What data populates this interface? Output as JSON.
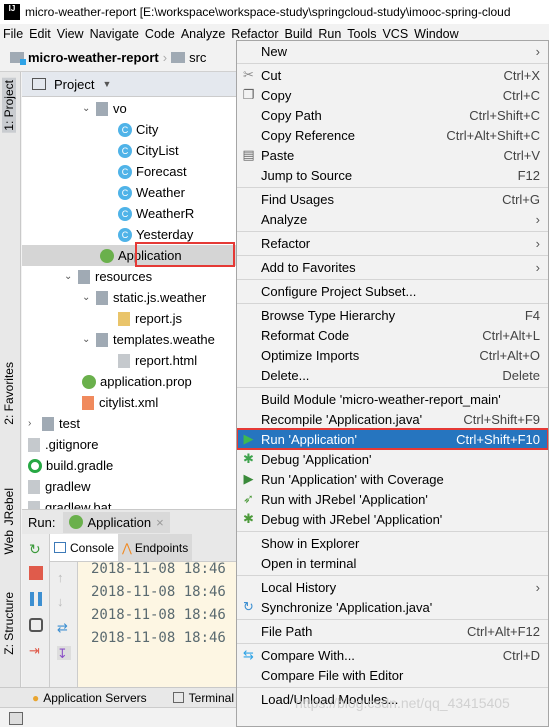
{
  "titlebar": {
    "title": "micro-weather-report [E:\\workspace\\workspace-study\\springcloud-study\\imooc-spring-cloud"
  },
  "menubar": [
    "File",
    "Edit",
    "View",
    "Navigate",
    "Code",
    "Analyze",
    "Refactor",
    "Build",
    "Run",
    "Tools",
    "VCS",
    "Window"
  ],
  "breadcrumb": [
    "micro-weather-report",
    "src"
  ],
  "sidebar_tabs": [
    "1: Project",
    "2: Favorites",
    "JRebel",
    "Web",
    "Z: Structure"
  ],
  "project": {
    "header": "Project"
  },
  "tree": [
    {
      "label": "vo",
      "type": "folder",
      "expanded": true,
      "indent": 5
    },
    {
      "label": "City",
      "type": "class",
      "indent": 7
    },
    {
      "label": "CityList",
      "type": "class",
      "indent": 7
    },
    {
      "label": "Forecast",
      "type": "class",
      "indent": 7
    },
    {
      "label": "Weather",
      "type": "class",
      "indent": 7
    },
    {
      "label": "WeatherR",
      "type": "class",
      "indent": 7
    },
    {
      "label": "Yesterday",
      "type": "class",
      "indent": 7
    },
    {
      "label": "Application",
      "type": "spring",
      "indent": 6,
      "selected": true
    },
    {
      "label": "resources",
      "type": "folder",
      "expanded": true,
      "indent": 4
    },
    {
      "label": "static.js.weather",
      "type": "folder",
      "expanded": true,
      "indent": 5
    },
    {
      "label": "report.js",
      "type": "js",
      "indent": 7
    },
    {
      "label": "templates.weathe",
      "type": "folder",
      "expanded": true,
      "indent": 5
    },
    {
      "label": "report.html",
      "type": "html",
      "indent": 7
    },
    {
      "label": "application.prop",
      "type": "spring",
      "indent": 5
    },
    {
      "label": "citylist.xml",
      "type": "xml",
      "indent": 5
    },
    {
      "label": "test",
      "type": "folder",
      "expanded": false,
      "indent": 2
    },
    {
      "label": ".gitignore",
      "type": "file",
      "indent": 2
    },
    {
      "label": "build.gradle",
      "type": "gradle",
      "indent": 2
    },
    {
      "label": "gradlew",
      "type": "file",
      "indent": 2
    },
    {
      "label": "gradlew.bat",
      "type": "file",
      "indent": 2
    }
  ],
  "run": {
    "label": "Run:",
    "tab": "Application",
    "subtabs": [
      "Console",
      "Endpoints"
    ],
    "console_lines": [
      "2018-11-08 18:46",
      "2018-11-08 18:46",
      "2018-11-08 18:46",
      "2018-11-08 18:46"
    ]
  },
  "bottom_tabs": [
    "Application Servers",
    "Terminal"
  ],
  "context_menu": [
    {
      "label": "New",
      "submenu": true
    },
    {
      "sep": true
    },
    {
      "label": "Cut",
      "shortcut": "Ctrl+X",
      "icon": "scissors-icon"
    },
    {
      "label": "Copy",
      "shortcut": "Ctrl+C",
      "icon": "copy-icon"
    },
    {
      "label": "Copy Path",
      "shortcut": "Ctrl+Shift+C"
    },
    {
      "label": "Copy Reference",
      "shortcut": "Ctrl+Alt+Shift+C"
    },
    {
      "label": "Paste",
      "shortcut": "Ctrl+V",
      "icon": "paste-icon"
    },
    {
      "label": "Jump to Source",
      "shortcut": "F12"
    },
    {
      "sep": true
    },
    {
      "label": "Find Usages",
      "shortcut": "Ctrl+G"
    },
    {
      "label": "Analyze",
      "submenu": true
    },
    {
      "sep": true
    },
    {
      "label": "Refactor",
      "submenu": true
    },
    {
      "sep": true
    },
    {
      "label": "Add to Favorites",
      "submenu": true
    },
    {
      "sep": true
    },
    {
      "label": "Configure Project Subset..."
    },
    {
      "sep": true
    },
    {
      "label": "Browse Type Hierarchy",
      "shortcut": "F4"
    },
    {
      "label": "Reformat Code",
      "shortcut": "Ctrl+Alt+L"
    },
    {
      "label": "Optimize Imports",
      "shortcut": "Ctrl+Alt+O"
    },
    {
      "label": "Delete...",
      "shortcut": "Delete"
    },
    {
      "sep": true
    },
    {
      "label": "Build Module 'micro-weather-report_main'"
    },
    {
      "label": "Recompile 'Application.java'",
      "shortcut": "Ctrl+Shift+F9"
    },
    {
      "label": "Run 'Application'",
      "shortcut": "Ctrl+Shift+F10",
      "icon": "run-icon",
      "highlighted": true
    },
    {
      "label": "Debug 'Application'",
      "icon": "debug-icon"
    },
    {
      "label": "Run 'Application' with Coverage",
      "icon": "coverage-icon"
    },
    {
      "label": "Run with JRebel 'Application'",
      "icon": "jrebel-run-icon"
    },
    {
      "label": "Debug with JRebel 'Application'",
      "icon": "jrebel-debug-icon"
    },
    {
      "sep": true
    },
    {
      "label": "Show in Explorer"
    },
    {
      "label": "Open in terminal"
    },
    {
      "sep": true
    },
    {
      "label": "Local History",
      "submenu": true
    },
    {
      "label": "Synchronize 'Application.java'",
      "icon": "sync-icon"
    },
    {
      "sep": true
    },
    {
      "label": "File Path",
      "shortcut": "Ctrl+Alt+F12"
    },
    {
      "sep": true
    },
    {
      "label": "Compare With...",
      "shortcut": "Ctrl+D",
      "icon": "compare-icon"
    },
    {
      "label": "Compare File with Editor"
    },
    {
      "sep": true
    },
    {
      "label": "Load/Unload Modules..."
    }
  ],
  "watermark": "https://blog.csdn.net/qq_43415405",
  "colors": {
    "highlight": "#2675bf",
    "annotation": "#e53935",
    "console_bg": "#fdf6e3"
  }
}
